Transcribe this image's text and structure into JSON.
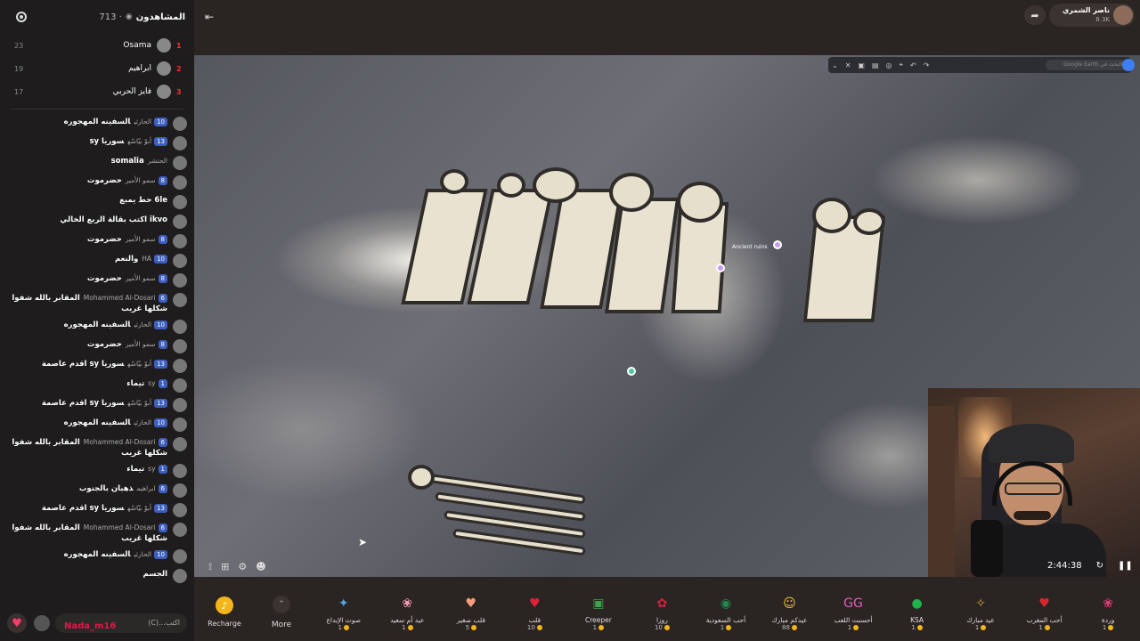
{
  "viewers": {
    "title": "المشاهدون",
    "count": "713 ·",
    "top": [
      {
        "rank": "1",
        "name": "Osama",
        "score": "23"
      },
      {
        "rank": "2",
        "name": "ابراهيم",
        "score": "19"
      },
      {
        "rank": "3",
        "name": "فايز الحربي",
        "score": "17"
      }
    ]
  },
  "chat": [
    {
      "user": "الحارثي",
      "level": "10",
      "text": "السفينه المهجوره"
    },
    {
      "user": "أبوّ بيّاسّه",
      "level": "13",
      "text": "سوريا sy"
    },
    {
      "user": "الحتشر",
      "level": "",
      "text": "somalia"
    },
    {
      "user": "سمو الأمير",
      "level": "8",
      "text": "حضرموت"
    },
    {
      "user": "",
      "level": "",
      "text": "6le حط يمبع"
    },
    {
      "user": "",
      "level": "",
      "text": "ikvo اكتب بقالة الربع الخالي"
    },
    {
      "user": "سمو الأمير",
      "level": "8",
      "text": "حضرموت"
    },
    {
      "user": "HA",
      "level": "10",
      "text": "والنعم"
    },
    {
      "user": "سمو الأمير",
      "level": "8",
      "text": "حضرموت"
    },
    {
      "user": "Mohammed Al-Dosari",
      "level": "6",
      "text": "المقابر بالله شفوا شكلها غريب"
    },
    {
      "user": "الحارثي",
      "level": "10",
      "text": "السفينه المهجوره"
    },
    {
      "user": "سمو الأمير",
      "level": "8",
      "text": "حضرموت"
    },
    {
      "user": "أبوّ بيّاسّه",
      "level": "13",
      "text": "سوريا sy اقدم عاصمة"
    },
    {
      "user": "sy",
      "level": "1",
      "text": "تيماء"
    },
    {
      "user": "أبوّ بيّاسّه",
      "level": "13",
      "text": "سوريا sy اقدم عاصمة"
    },
    {
      "user": "الحارثي",
      "level": "10",
      "text": "السفينه المهجوره"
    },
    {
      "user": "Mohammed Al-Dosari",
      "level": "6",
      "text": "المقابر بالله شفوا شكلها غريب"
    },
    {
      "user": "sy",
      "level": "1",
      "text": "تيماء"
    },
    {
      "user": "ابراهيم",
      "level": "6",
      "text": "ذهبان بالجنوب"
    },
    {
      "user": "أبوّ بيّاسّه",
      "level": "13",
      "text": "سوريا sy اقدم عاصمة"
    },
    {
      "user": "Mohammed Al-Dosari",
      "level": "6",
      "text": "المقابر بالله شفوا شكلها غريب"
    },
    {
      "user": "الحارثي",
      "level": "10",
      "text": "السفينه المهجوره"
    },
    {
      "user": "",
      "level": "",
      "text": "الجسم"
    }
  ],
  "compose": {
    "placeholder": "اكتب...(C)",
    "overlay_name": "Nada_m16"
  },
  "host": {
    "name": "ناصر الشمري",
    "likes": "8.3K"
  },
  "map": {
    "search_placeholder": "البحث في Google Earth",
    "pin_label": "Ancient ruins"
  },
  "webcam": {
    "timer": "2:44:38"
  },
  "giftbar": {
    "recharge_label": "Recharge",
    "more_label": "More",
    "gifts": [
      {
        "name": "صوت الإبداع",
        "price": "1",
        "color": "#4aa8e8",
        "icon": "✦"
      },
      {
        "name": "عيد أم سعيد",
        "price": "1",
        "color": "#f29bb2",
        "icon": "❀"
      },
      {
        "name": "قلب صغير",
        "price": "5",
        "color": "#f3a07a",
        "icon": "♥"
      },
      {
        "name": "قلب",
        "price": "10",
        "color": "#e0213a",
        "icon": "♥"
      },
      {
        "name": "Creeper",
        "price": "1",
        "color": "#3fa34d",
        "icon": "▣"
      },
      {
        "name": "روزا",
        "price": "10",
        "color": "#d2233e",
        "icon": "✿"
      },
      {
        "name": "أحب السعودية",
        "price": "1",
        "color": "#1f8a4c",
        "icon": "◉"
      },
      {
        "name": "عيدكم مبارك",
        "price": "88",
        "color": "#f0c040",
        "icon": "☺"
      },
      {
        "name": "أحسنت اللعب",
        "price": "1",
        "color": "#e75dbf",
        "icon": "GG"
      },
      {
        "name": "KSA",
        "price": "1",
        "color": "#21b34a",
        "icon": "●"
      },
      {
        "name": "عيد مبارك",
        "price": "1",
        "color": "#c89b3c",
        "icon": "✧"
      },
      {
        "name": "أحب المغرب",
        "price": "1",
        "color": "#d9262e",
        "icon": "♥"
      },
      {
        "name": "وردة",
        "price": "1",
        "color": "#e23d7a",
        "icon": "❀"
      }
    ]
  }
}
